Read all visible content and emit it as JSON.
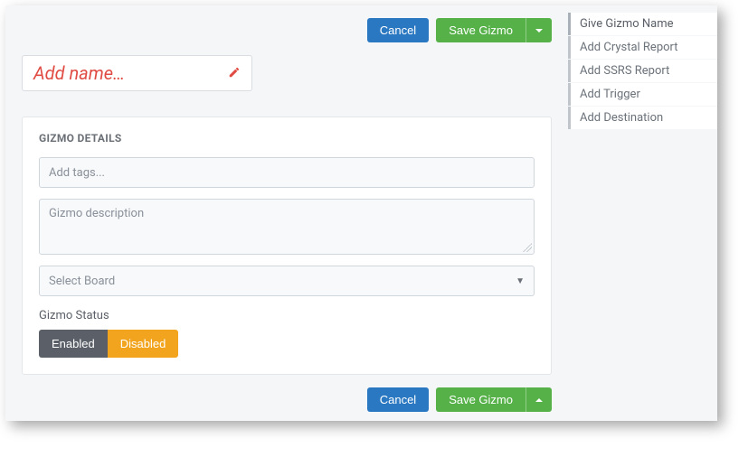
{
  "actions": {
    "cancel": "Cancel",
    "save": "Save Gizmo"
  },
  "name_input": {
    "placeholder": "Add name…"
  },
  "details": {
    "title": "GIZMO DETAILS",
    "tags_placeholder": "Add tags...",
    "description_placeholder": "Gizmo description",
    "board_placeholder": "Select Board",
    "status_label": "Gizmo Status",
    "status_enabled": "Enabled",
    "status_disabled": "Disabled"
  },
  "sidebar": {
    "items": [
      {
        "label": "Give Gizmo Name"
      },
      {
        "label": "Add Crystal Report"
      },
      {
        "label": "Add SSRS Report"
      },
      {
        "label": "Add Trigger"
      },
      {
        "label": "Add Destination"
      }
    ]
  }
}
